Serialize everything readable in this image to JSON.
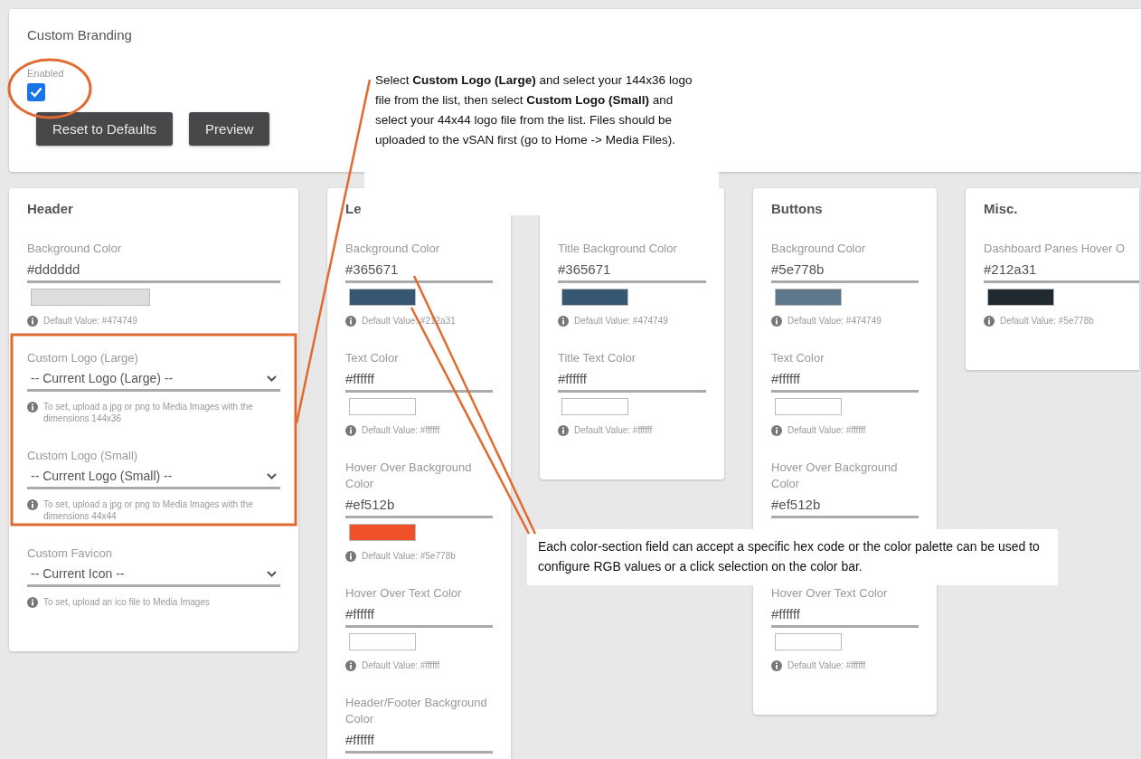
{
  "branding": {
    "title": "Custom Branding",
    "enabled": {
      "label": "Enabled",
      "checked": true
    },
    "buttons": [
      "Reset to Defaults",
      "Preview"
    ]
  },
  "columns": [
    {
      "title": "Header",
      "fields": [
        {
          "kind": "color",
          "label": "Background Color",
          "value": "#dddddd",
          "hint": "Default Value: #474749"
        },
        {
          "kind": "select",
          "label": "Custom Logo (Large)",
          "value": "-- Current Logo (Large) --",
          "hint": "To set, upload a jpg or png to Media Images with the dimensions 144x36"
        },
        {
          "kind": "select",
          "label": "Custom Logo (Small)",
          "value": "-- Current Logo (Small) --",
          "hint": "To set, upload a jpg or png to Media Images with the dimensions 44x44"
        },
        {
          "kind": "select",
          "label": "Custom Favicon",
          "value": "-- Current Icon --",
          "hint": "To set, upload an ico file to Media Images"
        }
      ]
    },
    {
      "title": "Le",
      "fields": [
        {
          "kind": "color",
          "label": "Background Color",
          "value": "#365671",
          "hint": "Default Value: #212a31"
        },
        {
          "kind": "color",
          "label": "Text Color",
          "value": "#ffffff",
          "hint": "Default Value: #ffffff"
        },
        {
          "kind": "color",
          "label": "Hover Over Background Color",
          "value": "#ef512b",
          "hint": "Default Value: #5e778b"
        },
        {
          "kind": "color",
          "label": "Hover Over Text Color",
          "value": "#ffffff",
          "hint": "Default Value: #ffffff"
        },
        {
          "kind": "color",
          "label": "Header/Footer Background Color",
          "value": "#ffffff"
        }
      ]
    },
    {
      "fields": [
        {
          "kind": "color",
          "label": "Title Background Color",
          "value": "#365671",
          "hint": "Default Value: #474749"
        },
        {
          "kind": "color",
          "label": "Title Text Color",
          "value": "#ffffff",
          "hint": "Default Value: #ffffff"
        }
      ]
    },
    {
      "title": "Buttons",
      "fields": [
        {
          "kind": "color",
          "label": "Background Color",
          "value": "#5e778b",
          "hint": "Default Value: #474749"
        },
        {
          "kind": "color",
          "label": "Text Color",
          "value": "#ffffff",
          "hint": "Default Value: #ffffff"
        },
        {
          "kind": "color",
          "label": "Hover Over Background Color",
          "value": "#ef512b",
          "swatch": false
        },
        {
          "kind": "color",
          "label": "Hover Over Text Color",
          "value": "#ffffff",
          "hint": "Default Value: #ffffff"
        }
      ]
    },
    {
      "title": "Misc.",
      "fields": [
        {
          "kind": "color",
          "label": "Dashboard Panes Hover O",
          "value": "#212a31",
          "hint": "Default Value: #5e778b"
        }
      ]
    }
  ],
  "callouts": [
    "Select **Custom Logo (Large)** and select your 144x36 logo file from the list, then select **Custom Logo (Small)** and select your 44x44 logo file from the list.  Files should  be uploaded to the vSAN first (go to Home -> Media Files).",
    "Each color-section field can accept a specific hex code or the color palette can be used to configure RGB values or a click selection on the color bar."
  ]
}
